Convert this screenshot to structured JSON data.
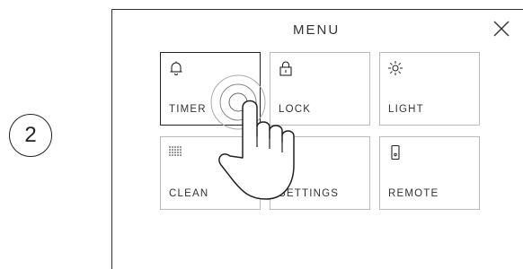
{
  "step": {
    "number": "2"
  },
  "menu": {
    "title": "MENU",
    "close_icon": "close-icon",
    "tiles": [
      {
        "label": "TIMER",
        "icon": "bell-icon",
        "selected": true
      },
      {
        "label": "LOCK",
        "icon": "lock-icon",
        "selected": false
      },
      {
        "label": "LIGHT",
        "icon": "sun-icon",
        "selected": false
      },
      {
        "label": "CLEAN",
        "icon": "dots-grid-icon",
        "selected": false
      },
      {
        "label": "SETTINGS",
        "icon": "gear-icon",
        "selected": false
      },
      {
        "label": "REMOTE",
        "icon": "remote-icon",
        "selected": false
      }
    ]
  },
  "colors": {
    "stroke": "#222222",
    "tile_border": "#bbbbbb"
  }
}
